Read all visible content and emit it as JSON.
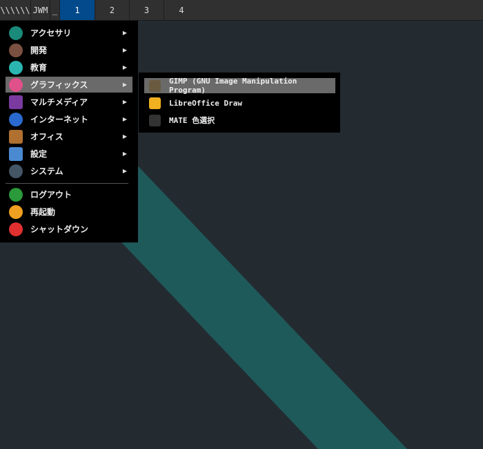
{
  "taskbar": {
    "launcher_label": "\\\\\\\\\\\\",
    "app_label": "JWM",
    "minimize_label": "_",
    "workspaces": [
      "1",
      "2",
      "3",
      "4"
    ],
    "active_workspace": "1"
  },
  "menu": {
    "items": [
      {
        "label": "アクセサリ",
        "icon": "accessories-icon"
      },
      {
        "label": "開発",
        "icon": "development-icon"
      },
      {
        "label": "教育",
        "icon": "education-icon"
      },
      {
        "label": "グラフィックス",
        "icon": "graphics-icon"
      },
      {
        "label": "マルチメディア",
        "icon": "multimedia-icon"
      },
      {
        "label": "インターネット",
        "icon": "internet-icon"
      },
      {
        "label": "オフィス",
        "icon": "office-icon"
      },
      {
        "label": "設定",
        "icon": "settings-icon"
      },
      {
        "label": "システム",
        "icon": "system-icon"
      }
    ],
    "actions": [
      {
        "label": "ログアウト",
        "icon": "logout-icon"
      },
      {
        "label": "再起動",
        "icon": "restart-icon"
      },
      {
        "label": "シャットダウン",
        "icon": "shutdown-icon"
      }
    ],
    "arrow": "▶"
  },
  "submenu": {
    "items": [
      {
        "label": "GIMP (GNU Image Manipulation Program)",
        "icon": "gimp-icon"
      },
      {
        "label": "LibreOffice Draw",
        "icon": "libreoffice-draw-icon"
      },
      {
        "label": "MATE 色選択",
        "icon": "color-picker-icon"
      }
    ]
  }
}
